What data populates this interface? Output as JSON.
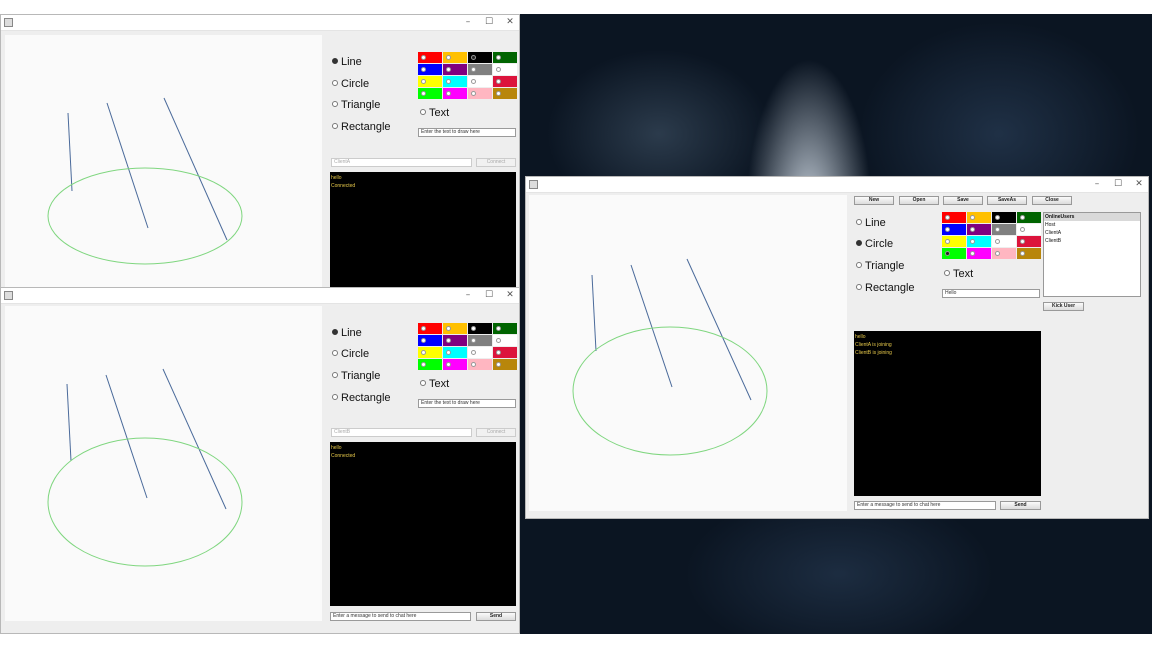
{
  "palette": [
    {
      "color": "#ff0000"
    },
    {
      "color": "#ffc000"
    },
    {
      "color": "#000000"
    },
    {
      "color": "#006400"
    },
    {
      "color": "#0000ff"
    },
    {
      "color": "#800080"
    },
    {
      "color": "#808080"
    },
    {
      "color": "#ffffff"
    },
    {
      "color": "#ffff00"
    },
    {
      "color": "#00ffff"
    },
    {
      "color": "#ffffff"
    },
    {
      "color": "#dc143c"
    },
    {
      "color": "#00ff00"
    },
    {
      "color": "#ff00ff"
    },
    {
      "color": "#ffb6c1"
    },
    {
      "color": "#b8860b"
    }
  ],
  "stroke_colors": {
    "lines": "#4a6a9a",
    "ellipse": "#7fd67f"
  },
  "window_controls": {
    "minimize": "–",
    "maximize": "☐",
    "close": "✕"
  },
  "client1": {
    "shapes": {
      "line": "Line",
      "circle": "Circle",
      "triangle": "Triangle",
      "rectangle": "Rectangle",
      "text": "Text"
    },
    "selected_shape": "Line",
    "selected_color_index": 2,
    "text_input_placeholder": "Enter the text to draw here",
    "name_input": "ClientA",
    "connect_label": "Connect",
    "chat": [
      "hello",
      "Connected"
    ]
  },
  "client2": {
    "shapes": {
      "line": "Line",
      "circle": "Circle",
      "triangle": "Triangle",
      "rectangle": "Rectangle",
      "text": "Text"
    },
    "selected_shape": "Line",
    "selected_color_index": -1,
    "text_input_placeholder": "Enter the text to draw here",
    "name_input": "ClientB",
    "connect_label": "Connect",
    "chat": [
      "hello",
      "Connected"
    ],
    "message_placeholder": "Enter a message to send to chat here",
    "send_label": "Send"
  },
  "host": {
    "toolbar": {
      "new": "New",
      "open": "Open",
      "save": "Save",
      "saveas": "SaveAs",
      "close": "Close"
    },
    "shapes": {
      "line": "Line",
      "circle": "Circle",
      "triangle": "Triangle",
      "rectangle": "Rectangle",
      "text": "Text"
    },
    "selected_shape": "Circle",
    "selected_color_index": 12,
    "text_input_value": "Hello",
    "online_header": "OnlineUsers",
    "users": [
      "Host",
      "ClientA",
      "ClientB"
    ],
    "kick_label": "Kick User",
    "chat": [
      "hello",
      "ClientA is joining",
      "ClientB is joining"
    ],
    "message_placeholder": "Enter a message to send to chat here",
    "send_label": "Send"
  }
}
